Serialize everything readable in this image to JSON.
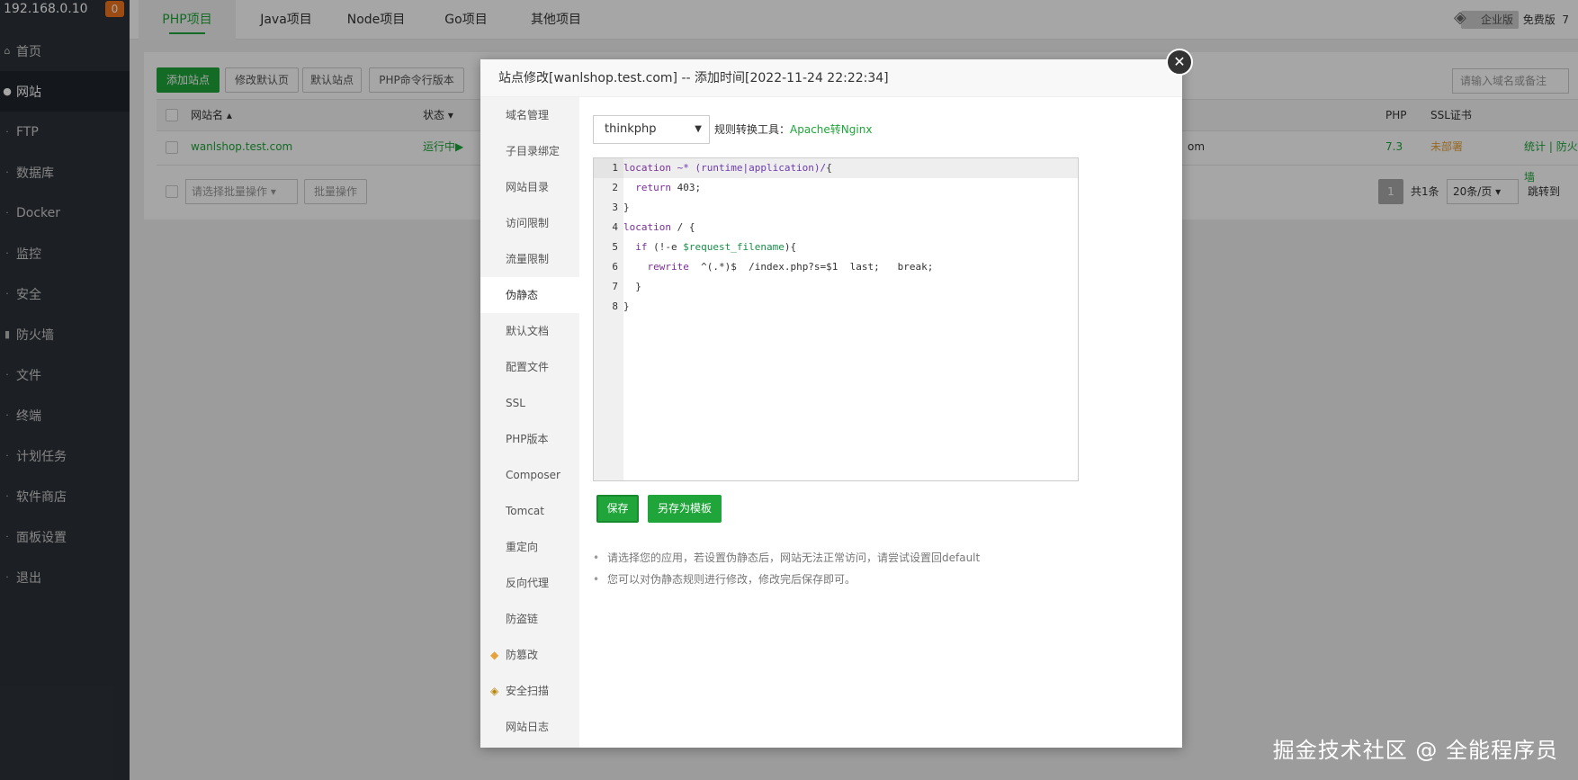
{
  "sidebar": {
    "ip": "192.168.0.10",
    "badge": "0",
    "items": [
      {
        "icon": "home-icon",
        "label": "首页"
      },
      {
        "icon": "globe-icon",
        "label": "网站"
      },
      {
        "icon": "ftp-icon",
        "label": "FTP"
      },
      {
        "icon": "database-icon",
        "label": "数据库"
      },
      {
        "icon": "docker-icon",
        "label": "Docker"
      },
      {
        "icon": "monitor-icon",
        "label": "监控"
      },
      {
        "icon": "shield-icon",
        "label": "安全"
      },
      {
        "icon": "firewall-icon",
        "label": "防火墙"
      },
      {
        "icon": "folder-icon",
        "label": "文件"
      },
      {
        "icon": "terminal-icon",
        "label": "终端"
      },
      {
        "icon": "clock-icon",
        "label": "计划任务"
      },
      {
        "icon": "store-icon",
        "label": "软件商店"
      },
      {
        "icon": "settings-icon",
        "label": "面板设置"
      },
      {
        "icon": "logout-icon",
        "label": "退出"
      }
    ]
  },
  "topbar": {
    "tabs": [
      "PHP项目",
      "Java项目",
      "Node项目",
      "Go项目",
      "其他项目"
    ],
    "enterprise": "企业版",
    "free": "免费版",
    "free_suffix": "7"
  },
  "panel": {
    "buttons": [
      "添加站点",
      "修改默认页",
      "默认站点",
      "PHP命令行版本"
    ],
    "search_placeholder": "请输入域名或备注",
    "columns": {
      "name": "网站名",
      "status": "状态",
      "php": "PHP",
      "ssl": "SSL证书"
    },
    "row": {
      "name": "wanlshop.test.com",
      "status": "运行中▶",
      "domain_tail": "om",
      "php": "7.3",
      "ssl": "未部署",
      "stats": "统计",
      "sep": "|",
      "firewall": "防火墙"
    },
    "batch_select": "请选择批量操作",
    "batch_button": "批量操作",
    "pager": {
      "page": "1",
      "total": "共1条",
      "per_page": "20条/页",
      "jump": "跳转到"
    }
  },
  "modal": {
    "title": "站点修改[wanlshop.test.com] -- 添加时间[2022-11-24 22:22:34]",
    "close": "✕",
    "nav": [
      "域名管理",
      "子目录绑定",
      "网站目录",
      "访问限制",
      "流量限制",
      "伪静态",
      "默认文档",
      "配置文件",
      "SSL",
      "PHP版本",
      "Composer",
      "Tomcat",
      "重定向",
      "反向代理",
      "防盗链",
      "防篡改",
      "安全扫描",
      "网站日志"
    ],
    "rule_select": "thinkphp",
    "tool_label": "规则转换工具：",
    "tool_link": "Apache转Nginx",
    "line_numbers": [
      "1",
      "2",
      "3",
      "4",
      "5",
      "6",
      "7",
      "8"
    ],
    "save": "保存",
    "save_template": "另存为模板",
    "tips": [
      "请选择您的应用，若设置伪静态后，网站无法正常访问，请尝试设置回default",
      "您可以对伪静态规则进行修改，修改完后保存即可。"
    ]
  },
  "watermark": "掘金技术社区 @ 全能程序员"
}
